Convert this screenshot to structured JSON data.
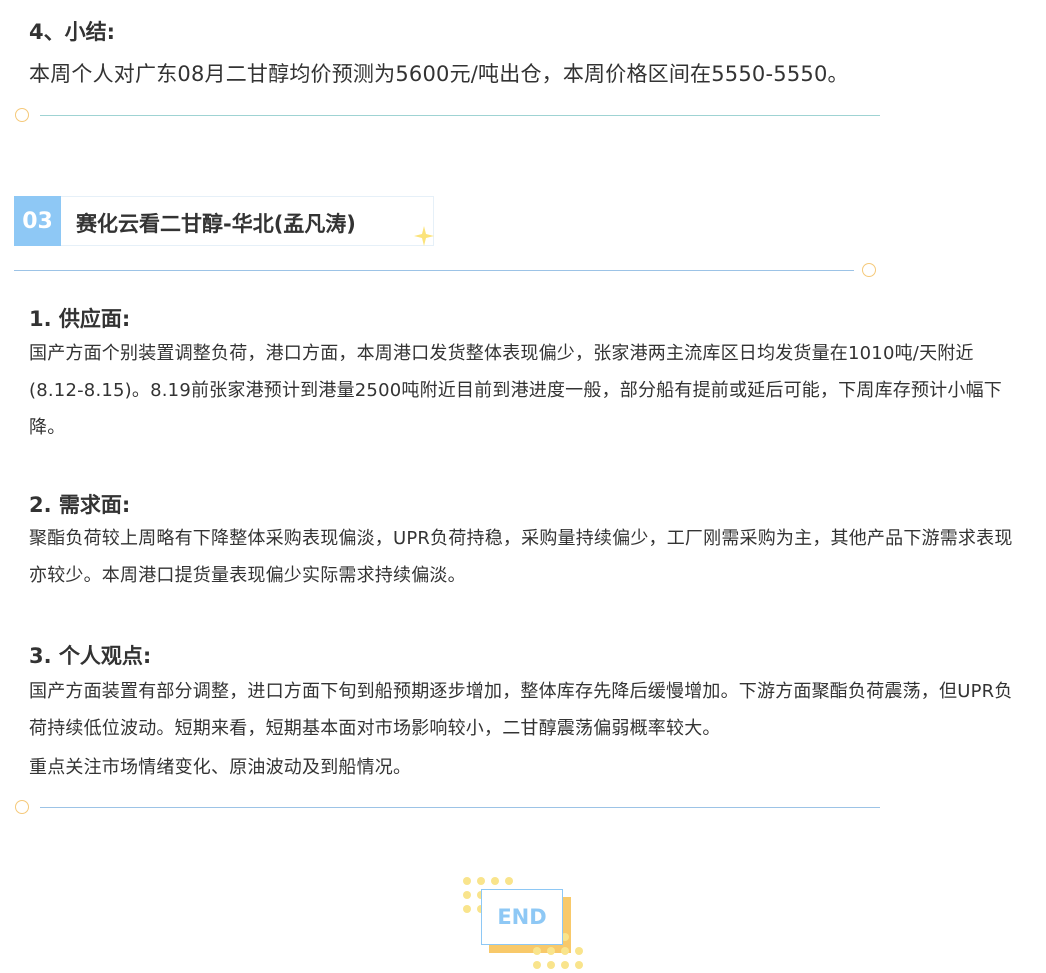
{
  "summary": {
    "heading": "4、小结:",
    "text": "本周个人对广东08月二甘醇均价预测为5600元/吨出仓，本周价格区间在5550-5550。"
  },
  "section": {
    "number": "03",
    "title": "赛化云看二甘醇-华北(孟凡涛)"
  },
  "supply": {
    "heading": "1. 供应面:",
    "text": "国产方面个别装置调整负荷，港口方面，本周港口发货整体表现偏少，张家港两主流库区日均发货量在1010吨/天附近(8.12-8.15)。8.19前张家港预计到港量2500吨附近目前到港进度一般，部分船有提前或延后可能，下周库存预计小幅下降。"
  },
  "demand": {
    "heading": "2. 需求面:",
    "text": "聚酯负荷较上周略有下降整体采购表现偏淡，UPR负荷持稳，采购量持续偏少，工厂刚需采购为主，其他产品下游需求表现亦较少。本周港口提货量表现偏少实际需求持续偏淡。"
  },
  "opinion": {
    "heading": "3. 个人观点:",
    "text": "国产方面装置有部分调整，进口方面下旬到船预期逐步增加，整体库存先降后缓慢增加。下游方面聚酯负荷震荡，但UPR负荷持续低位波动。短期来看，短期基本面对市场影响较小，二甘醇震荡偏弱概率较大。",
    "text2": "重点关注市场情绪变化、原油波动及到船情况。"
  },
  "end_label": "END",
  "colors": {
    "accent_blue": "#8ec8f5",
    "accent_yellow": "#f8c96a",
    "dot_yellow": "#f9e48c",
    "line_teal": "#9fd3d3",
    "line_blue": "#9cc3e6"
  },
  "icons": {
    "sparkle": "sparkle-icon"
  }
}
